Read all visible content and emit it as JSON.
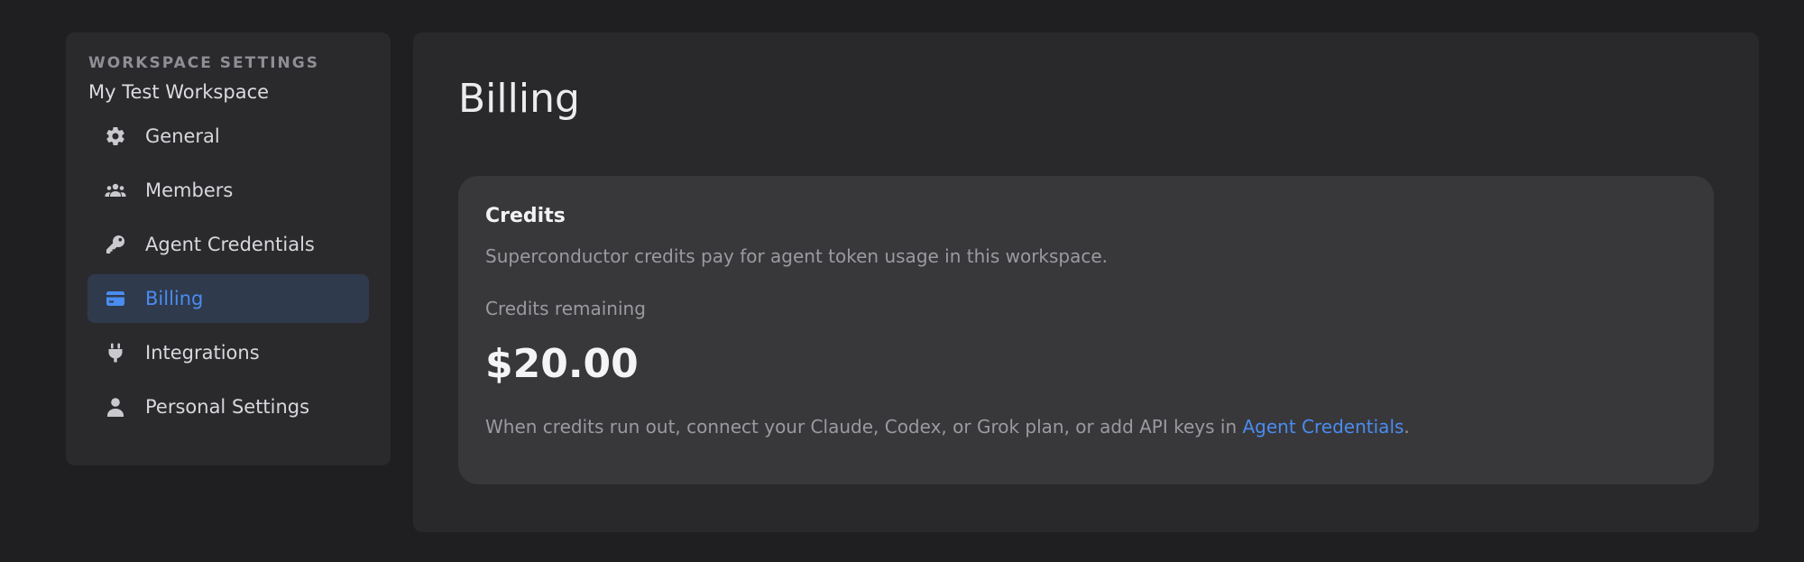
{
  "sidebar": {
    "heading": "WORKSPACE SETTINGS",
    "workspace_name": "My Test Workspace",
    "items": [
      {
        "label": "General",
        "icon": "gear-icon",
        "active": false
      },
      {
        "label": "Members",
        "icon": "users-icon",
        "active": false
      },
      {
        "label": "Agent Credentials",
        "icon": "key-icon",
        "active": false
      },
      {
        "label": "Billing",
        "icon": "credit-card-icon",
        "active": true
      },
      {
        "label": "Integrations",
        "icon": "plug-icon",
        "active": false
      },
      {
        "label": "Personal Settings",
        "icon": "user-icon",
        "active": false
      }
    ]
  },
  "main": {
    "title": "Billing",
    "card": {
      "title": "Credits",
      "description": "Superconductor credits pay for agent token usage in this workspace.",
      "credits_label": "Credits remaining",
      "credits_amount": "$20.00",
      "note_prefix": "When credits run out, connect your Claude, Codex, or Grok plan, or add API keys in ",
      "note_link": "Agent Credentials",
      "note_suffix": "."
    }
  },
  "colors": {
    "background": "#1f1f21",
    "panel": "#29292c",
    "card": "#38383b",
    "accent": "#4a8cf0",
    "active_bg": "#2f3a4d"
  }
}
